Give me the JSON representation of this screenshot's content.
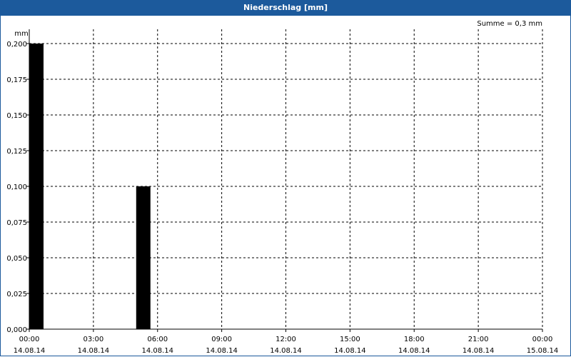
{
  "window": {
    "title": "Niederschlag [mm]"
  },
  "chart_data": {
    "type": "bar",
    "title": "",
    "ylabel": "mm",
    "xlabel": "",
    "summary": "Summe = 0,3 mm",
    "ylim": [
      0,
      0.2
    ],
    "xlim_hours": [
      0,
      24
    ],
    "y_ticks": [
      "0,000",
      "0,025",
      "0,050",
      "0,075",
      "0,100",
      "0,125",
      "0,150",
      "0,175",
      "0,200"
    ],
    "x_ticks": [
      {
        "time": "00:00",
        "date": "14.08.14"
      },
      {
        "time": "03:00",
        "date": "14.08.14"
      },
      {
        "time": "06:00",
        "date": "14.08.14"
      },
      {
        "time": "09:00",
        "date": "14.08.14"
      },
      {
        "time": "12:00",
        "date": "14.08.14"
      },
      {
        "time": "15:00",
        "date": "14.08.14"
      },
      {
        "time": "18:00",
        "date": "14.08.14"
      },
      {
        "time": "21:00",
        "date": "14.08.14"
      },
      {
        "time": "00:00",
        "date": "15.08.14"
      }
    ],
    "bars": [
      {
        "start": "14.08.14 00:00",
        "end": "14.08.14 00:40",
        "value": 0.2
      },
      {
        "start": "14.08.14 05:00",
        "end": "14.08.14 05:40",
        "value": 0.1
      }
    ],
    "grid": true,
    "bar_color": "#000000"
  }
}
